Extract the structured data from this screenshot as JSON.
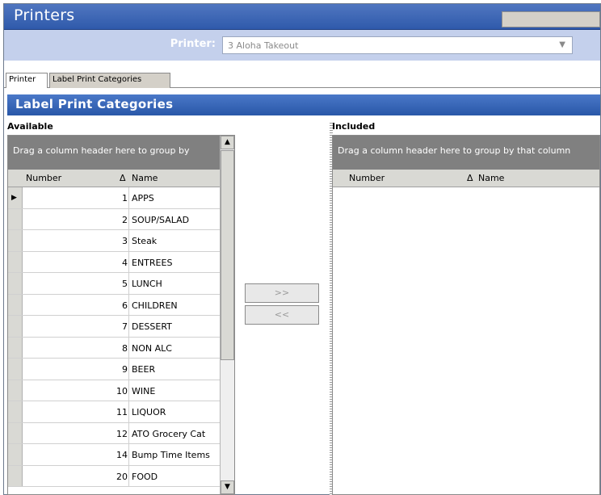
{
  "window": {
    "title": "Printers"
  },
  "printer": {
    "label": "Printer:",
    "value": "3 Aloha Takeout"
  },
  "tabs": [
    {
      "label": "Printer"
    },
    {
      "label": "Label Print Categories"
    }
  ],
  "section": {
    "title": "Label Print Categories"
  },
  "available": {
    "label": "Available",
    "group_hint": "Drag a column header here to group by",
    "columns": {
      "number": "Number",
      "sort_glyph": "Δ",
      "name": "Name"
    },
    "rows": [
      {
        "number": "1",
        "name": "APPS"
      },
      {
        "number": "2",
        "name": "SOUP/SALAD"
      },
      {
        "number": "3",
        "name": "Steak"
      },
      {
        "number": "4",
        "name": "ENTREES"
      },
      {
        "number": "5",
        "name": "LUNCH"
      },
      {
        "number": "6",
        "name": "CHILDREN"
      },
      {
        "number": "7",
        "name": "DESSERT"
      },
      {
        "number": "8",
        "name": "NON ALC"
      },
      {
        "number": "9",
        "name": "BEER"
      },
      {
        "number": "10",
        "name": "WINE"
      },
      {
        "number": "11",
        "name": "LIQUOR"
      },
      {
        "number": "12",
        "name": "ATO Grocery Cat"
      },
      {
        "number": "14",
        "name": "Bump Time Items"
      },
      {
        "number": "20",
        "name": "FOOD"
      }
    ],
    "selected_row_marker": "▶"
  },
  "included": {
    "label": "Included",
    "group_hint": "Drag a column header here to group by that column",
    "columns": {
      "number": "Number",
      "sort_glyph": "Δ",
      "name": "Name"
    }
  },
  "buttons": {
    "add": ">>",
    "remove": "<<"
  },
  "icons": {
    "dropdown": "chevron-down-icon",
    "scroll_up": "arrow-up-icon",
    "scroll_down": "arrow-down-icon"
  },
  "colors": {
    "title_bar": "#2f5aab",
    "header_band": "#c4d0ec",
    "section_head": "#2957a8",
    "group_bar": "#808080"
  }
}
